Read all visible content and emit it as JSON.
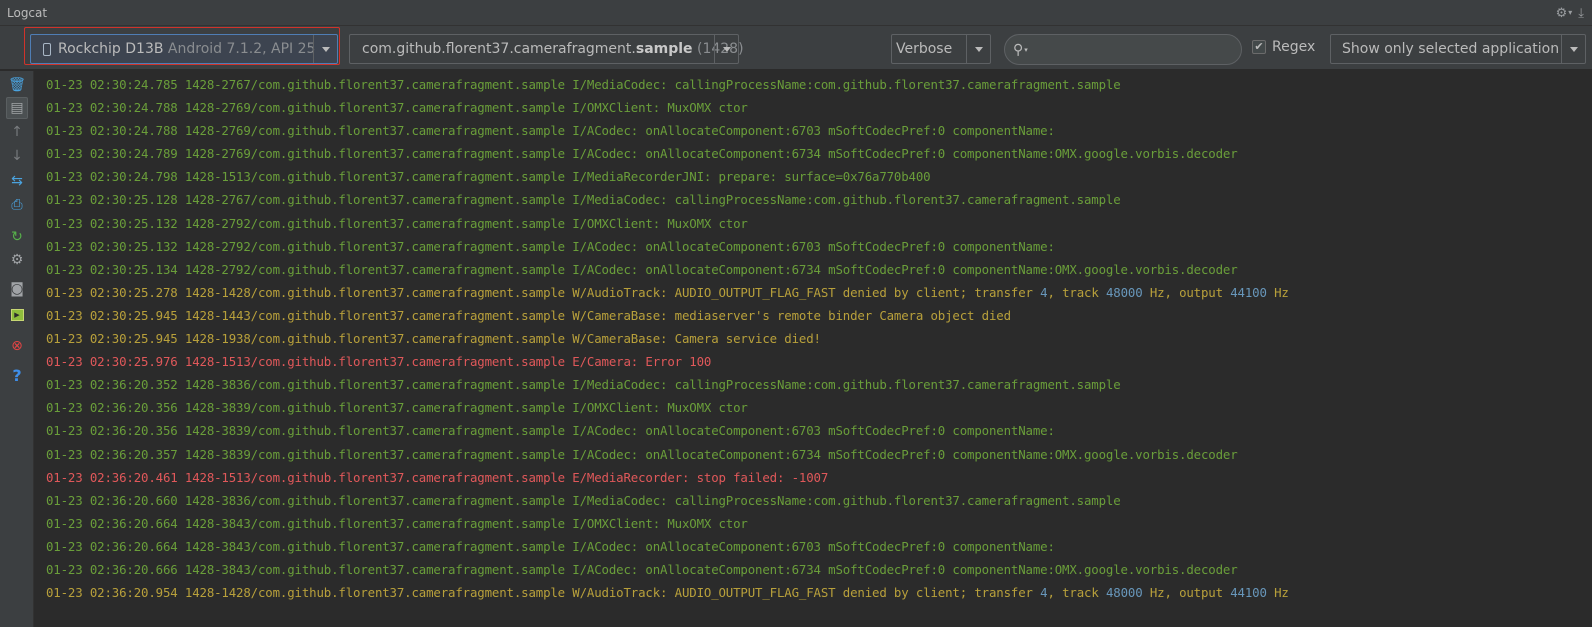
{
  "window": {
    "title": "Logcat"
  },
  "title_icons": [
    "gear-icon",
    "pin-icon"
  ],
  "toolbar": {
    "device": {
      "name": "Rockchip D13B",
      "detail": "Android 7.1.2, API 25"
    },
    "app": {
      "prefix": "com.github.florent37.camerafragment.",
      "bold": "sample",
      "pid": "(1428)"
    },
    "log_level": "Verbose",
    "search": {
      "value": "",
      "placeholder": ""
    },
    "regex": {
      "label": "Regex",
      "checked": true
    },
    "filter": "Show only selected application"
  },
  "sidebar_icons": [
    "trash-icon",
    "scroll-to-end-icon",
    "up-arrow-icon",
    "down-arrow-icon",
    "soft-wrap-icon",
    "print-icon",
    "restart-icon",
    "settings-icon",
    "screenshot-icon",
    "screen-record-icon",
    "terminate-icon",
    "help-icon"
  ],
  "colors": {
    "info": "#6a9e3a",
    "warn": "#b8a03b",
    "error": "#e0585a",
    "number": "#6897bb",
    "highlight": "#d0332b"
  },
  "log_lines": [
    {
      "level": "I",
      "text": "01-23 02:30:24.785 1428-2767/com.github.florent37.camerafragment.sample I/MediaCodec: callingProcessName:com.github.florent37.camerafragment.sample"
    },
    {
      "level": "I",
      "text": "01-23 02:30:24.788 1428-2769/com.github.florent37.camerafragment.sample I/OMXClient: MuxOMX ctor"
    },
    {
      "level": "I",
      "text": "01-23 02:30:24.788 1428-2769/com.github.florent37.camerafragment.sample I/ACodec: onAllocateComponent:6703 mSoftCodecPref:0 componentName:"
    },
    {
      "level": "I",
      "text": "01-23 02:30:24.789 1428-2769/com.github.florent37.camerafragment.sample I/ACodec: onAllocateComponent:6734 mSoftCodecPref:0 componentName:OMX.google.vorbis.decoder"
    },
    {
      "level": "I",
      "text": "01-23 02:30:24.798 1428-1513/com.github.florent37.camerafragment.sample I/MediaRecorderJNI: prepare: surface=0x76a770b400"
    },
    {
      "level": "I",
      "text": "01-23 02:30:25.128 1428-2767/com.github.florent37.camerafragment.sample I/MediaCodec: callingProcessName:com.github.florent37.camerafragment.sample"
    },
    {
      "level": "I",
      "text": "01-23 02:30:25.132 1428-2792/com.github.florent37.camerafragment.sample I/OMXClient: MuxOMX ctor"
    },
    {
      "level": "I",
      "text": "01-23 02:30:25.132 1428-2792/com.github.florent37.camerafragment.sample I/ACodec: onAllocateComponent:6703 mSoftCodecPref:0 componentName:"
    },
    {
      "level": "I",
      "text": "01-23 02:30:25.134 1428-2792/com.github.florent37.camerafragment.sample I/ACodec: onAllocateComponent:6734 mSoftCodecPref:0 componentName:OMX.google.vorbis.decoder"
    },
    {
      "level": "W",
      "text": "01-23 02:30:25.278 1428-1428/com.github.florent37.camerafragment.sample W/AudioTrack: AUDIO_OUTPUT_FLAG_FAST denied by client; transfer 4, track 48000 Hz, output 44100 Hz"
    },
    {
      "level": "W",
      "text": "01-23 02:30:25.945 1428-1443/com.github.florent37.camerafragment.sample W/CameraBase: mediaserver's remote binder Camera object died"
    },
    {
      "level": "W",
      "text": "01-23 02:30:25.945 1428-1938/com.github.florent37.camerafragment.sample W/CameraBase: Camera service died!"
    },
    {
      "level": "E",
      "text": "01-23 02:30:25.976 1428-1513/com.github.florent37.camerafragment.sample E/Camera: Error 100"
    },
    {
      "level": "I",
      "text": "01-23 02:36:20.352 1428-3836/com.github.florent37.camerafragment.sample I/MediaCodec: callingProcessName:com.github.florent37.camerafragment.sample"
    },
    {
      "level": "I",
      "text": "01-23 02:36:20.356 1428-3839/com.github.florent37.camerafragment.sample I/OMXClient: MuxOMX ctor"
    },
    {
      "level": "I",
      "text": "01-23 02:36:20.356 1428-3839/com.github.florent37.camerafragment.sample I/ACodec: onAllocateComponent:6703 mSoftCodecPref:0 componentName:"
    },
    {
      "level": "I",
      "text": "01-23 02:36:20.357 1428-3839/com.github.florent37.camerafragment.sample I/ACodec: onAllocateComponent:6734 mSoftCodecPref:0 componentName:OMX.google.vorbis.decoder"
    },
    {
      "level": "E",
      "text": "01-23 02:36:20.461 1428-1513/com.github.florent37.camerafragment.sample E/MediaRecorder: stop failed: -1007"
    },
    {
      "level": "I",
      "text": "01-23 02:36:20.660 1428-3836/com.github.florent37.camerafragment.sample I/MediaCodec: callingProcessName:com.github.florent37.camerafragment.sample"
    },
    {
      "level": "I",
      "text": "01-23 02:36:20.664 1428-3843/com.github.florent37.camerafragment.sample I/OMXClient: MuxOMX ctor"
    },
    {
      "level": "I",
      "text": "01-23 02:36:20.664 1428-3843/com.github.florent37.camerafragment.sample I/ACodec: onAllocateComponent:6703 mSoftCodecPref:0 componentName:"
    },
    {
      "level": "I",
      "text": "01-23 02:36:20.666 1428-3843/com.github.florent37.camerafragment.sample I/ACodec: onAllocateComponent:6734 mSoftCodecPref:0 componentName:OMX.google.vorbis.decoder"
    },
    {
      "level": "W",
      "text": "01-23 02:36:20.954 1428-1428/com.github.florent37.camerafragment.sample W/AudioTrack: AUDIO_OUTPUT_FLAG_FAST denied by client; transfer 4, track 48000 Hz, output 44100 Hz"
    }
  ]
}
